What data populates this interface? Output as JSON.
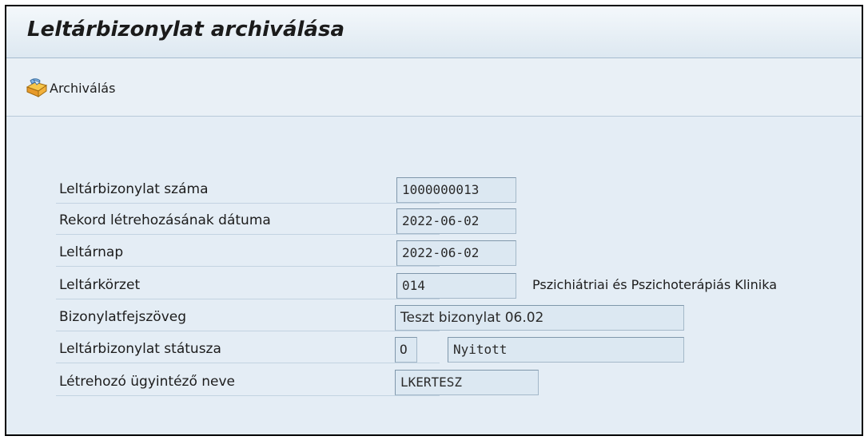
{
  "title": "Leltárbizonylat archiválása",
  "toolbar": {
    "archive_icon": "archive-box-icon",
    "archive_label": "Archiválás"
  },
  "form": {
    "doc_number": {
      "label": "Leltárbizonylat száma",
      "value": "1000000013"
    },
    "created_date": {
      "label": "Rekord létrehozásának dátuma",
      "value": "2022-06-02"
    },
    "inventory_day": {
      "label": "Leltárnap",
      "value": "2022-06-02"
    },
    "district": {
      "label": "Leltárkörzet",
      "value": "014",
      "description": "Pszichiátriai és Pszichoterápiás Klinika"
    },
    "header_text": {
      "label": "Bizonylatfejszöveg",
      "value": "Teszt bizonylat 06.02"
    },
    "status": {
      "label": "Leltárbizonylat státusza",
      "code": "O",
      "text": "Nyitott"
    },
    "creator": {
      "label": "Létrehozó ügyintéző neve",
      "value": "LKERTESZ"
    }
  },
  "colors": {
    "background": "#e4edf5",
    "field_background": "#dce8f2",
    "field_border": "#a4b8c9",
    "frame_border": "#000000"
  }
}
